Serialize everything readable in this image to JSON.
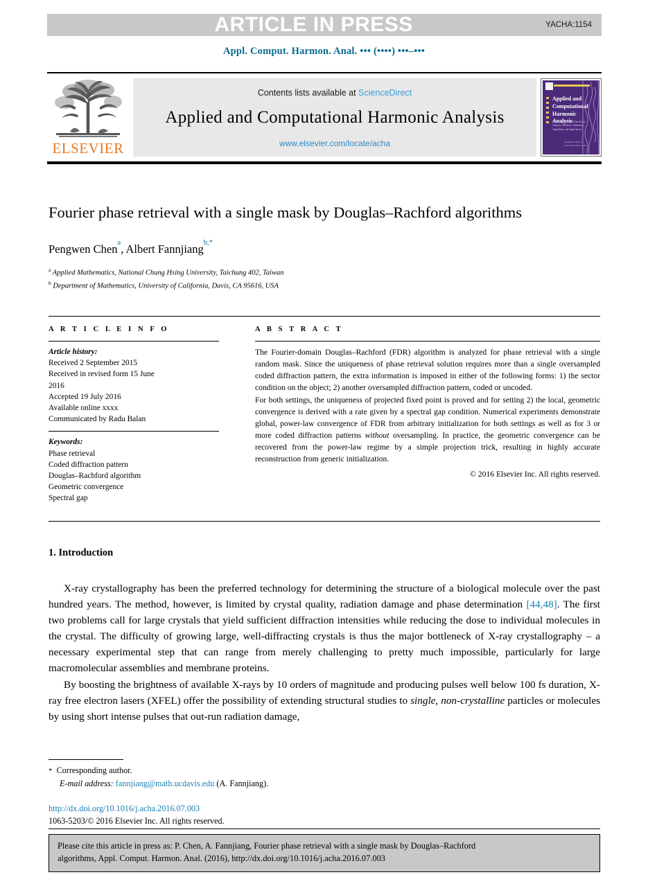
{
  "banner": {
    "text": "ARTICLE IN PRESS",
    "code": "YACHA:1154",
    "bg_color": "#c8c8c8",
    "text_color": "#ffffff"
  },
  "running_head": {
    "journal_line": "Appl. Comput. Harmon. Anal. ••• (••••) •••–•••",
    "color": "#0a6a8e"
  },
  "masthead": {
    "publisher": "ELSEVIER",
    "publisher_color": "#e87722",
    "contents_prefix": "Contents lists available at ",
    "contents_link": "ScienceDirect",
    "journal_title": "Applied and Computational Harmonic Analysis",
    "journal_url": "www.elsevier.com/locate/acha",
    "link_color": "#3c9bd6",
    "cover": {
      "title": "Applied and Computational Harmonic Analysis",
      "subtitle": "Time-Frequency and Time-Scale Analysis, Wavelets, Numerical Algorithms, and Applications",
      "bottom": "Available online at www.sciencedirect.com",
      "bg_color": "#4c2a7a",
      "accent_color": "#e8c84a"
    }
  },
  "article": {
    "title": "Fourier phase retrieval with a single mask by Douglas–Rachford algorithms",
    "authors": [
      {
        "name": "Pengwen Chen",
        "marks": "a"
      },
      {
        "name": "Albert Fannjiang",
        "marks": "b,*"
      }
    ],
    "authors_line_plain": "Pengwen Chen a, Albert Fannjiang b,*",
    "affiliations": [
      {
        "mark": "a",
        "text": "Applied Mathematics, National Chung Hsing University, Taichung 402, Taiwan"
      },
      {
        "mark": "b",
        "text": "Department of Mathematics, University of California, Davis, CA 95616, USA"
      }
    ]
  },
  "info": {
    "heading": "A R T I C L E  I N F O",
    "history_label": "Article history:",
    "history": [
      "Received 2 September 2015",
      "Received in revised form 15 June",
      "2016",
      "Accepted 19 July 2016",
      "Available online xxxx",
      "Communicated by Radu Balan"
    ],
    "keywords_label": "Keywords:",
    "keywords": [
      "Phase retrieval",
      "Coded diffraction pattern",
      "Douglas–Rachford algorithm",
      "Geometric convergence",
      "Spectral gap"
    ]
  },
  "abstract": {
    "heading": "A B S T R A C T",
    "para1": "The Fourier-domain Douglas–Rachford (FDR) algorithm is analyzed for phase retrieval with a single random mask. Since the uniqueness of phase retrieval solution requires more than a single oversampled coded diffraction pattern, the extra information is imposed in either of the following forms: 1) the sector condition on the object; 2) another oversampled diffraction pattern, coded or uncoded.",
    "para2_a": "For both settings, the uniqueness of projected fixed point is proved and for setting 2) the local, geometric convergence is derived with a rate given by a spectral gap condition. Numerical experiments demonstrate global, power-law convergence of FDR from arbitrary initialization for both settings as well as for 3 or more coded diffraction patterns ",
    "para2_italic": "without",
    "para2_b": " oversampling. In practice, the geometric convergence can be recovered from the power-law regime by a simple projection trick, resulting in highly accurate reconstruction from generic initialization.",
    "copyright": "© 2016 Elsevier Inc. All rights reserved."
  },
  "introduction": {
    "heading": "1. Introduction",
    "p1_a": "X-ray crystallography has been the preferred technology for determining the structure of a biological molecule over the past hundred years. The method, however, is limited by crystal quality, radiation damage and phase determination ",
    "p1_ref": "[44,48]",
    "p1_b": ". The first two problems call for large crystals that yield sufficient diffraction intensities while reducing the dose to individual molecules in the crystal. The difficulty of growing large, well-diffracting crystals is thus the major bottleneck of X-ray crystallography – a necessary experimental step that can range from merely challenging to pretty much impossible, particularly for large macromolecular assemblies and membrane proteins.",
    "p2_a": "By boosting the brightness of available X-rays by 10 orders of magnitude and producing pulses well below 100 fs duration, X-ray free electron lasers (XFEL) offer the possibility of extending structural studies to ",
    "p2_italic": "single, non-crystalline",
    "p2_b": " particles or molecules by using short intense pulses that out-run radiation damage,"
  },
  "footnotes": {
    "corresponding": "Corresponding author.",
    "email_label": "E-mail address:",
    "email": "fannjiang@math.ucdavis.edu",
    "email_suffix": "(A. Fannjiang).",
    "doi": "http://dx.doi.org/10.1016/j.acha.2016.07.003",
    "rights": "1063-5203/© 2016 Elsevier Inc. All rights reserved.",
    "link_color": "#1a7fb5"
  },
  "cite_box": {
    "line1": "Please cite this article in press as: P. Chen, A. Fannjiang, Fourier phase retrieval with a single mask by Douglas–Rachford",
    "line2": "algorithms, Appl. Comput. Harmon. Anal. (2016), http://dx.doi.org/10.1016/j.acha.2016.07.003",
    "bg_color": "#c8c8c8"
  }
}
